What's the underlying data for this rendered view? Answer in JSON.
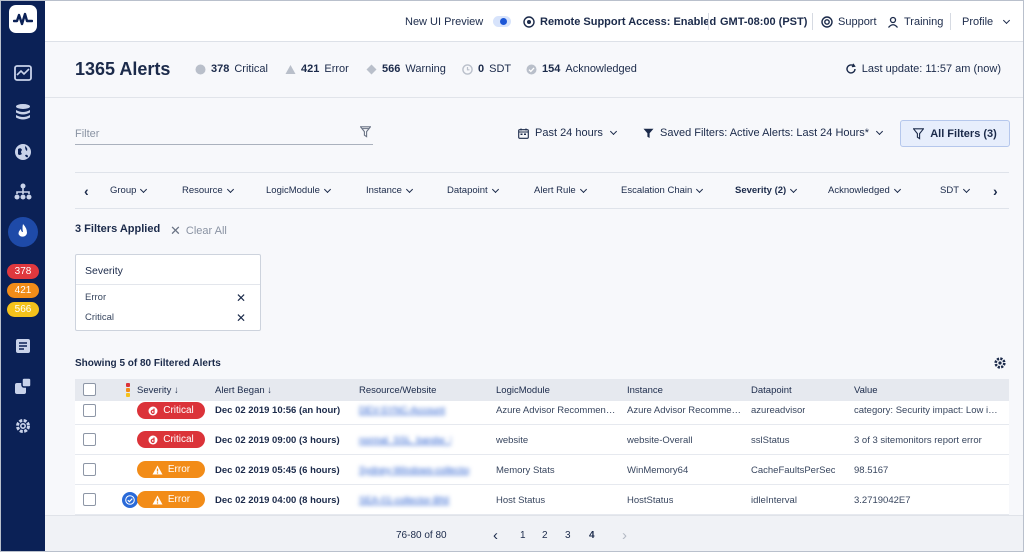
{
  "sidebar": {
    "badges": [
      {
        "value": "378",
        "color": "#e0383e"
      },
      {
        "value": "421",
        "color": "#f28c18"
      },
      {
        "value": "566",
        "color": "#f5c21b"
      }
    ]
  },
  "topbar": {
    "new_ui_preview": "New UI Preview",
    "remote_support": "Remote Support Access: Enabled",
    "timezone": "GMT-08:00 (PST)",
    "support": "Support",
    "training": "Training",
    "profile": "Profile"
  },
  "summary": {
    "title": "1365 Alerts",
    "critical_count": "378",
    "critical_label": "Critical",
    "error_count": "421",
    "error_label": "Error",
    "warning_count": "566",
    "warning_label": "Warning",
    "sdt_count": "0",
    "sdt_label": "SDT",
    "ack_count": "154",
    "ack_label": "Acknowledged",
    "last_update": "Last update: 11:57 am (now)"
  },
  "filters": {
    "placeholder": "Filter",
    "time_range": "Past 24 hours",
    "saved_filters": "Saved Filters: Active Alerts: Last 24 Hours*",
    "all_filters": "All Filters (3)"
  },
  "column_filters": [
    "Group",
    "Resource",
    "LogicModule",
    "Instance",
    "Datapoint",
    "Alert Rule",
    "Escalation Chain",
    "Severity (2)",
    "Acknowledged",
    "SDT"
  ],
  "applied": {
    "label": "3 Filters Applied",
    "clear": "Clear All"
  },
  "severity_card": {
    "title": "Severity",
    "items": [
      "Error",
      "Critical"
    ]
  },
  "table": {
    "showing": "Showing 5 of 80 Filtered Alerts",
    "headers": {
      "severity": "Severity",
      "began": "Alert Began",
      "resource": "Resource/Website",
      "logicmodule": "LogicModule",
      "instance": "Instance",
      "datapoint": "Datapoint",
      "value": "Value"
    },
    "rows": [
      {
        "severity": "Critical",
        "began": "Dec 02 2019 10:56 (an hour)",
        "resource": "DEV-SYNC-Account",
        "logicmodule": "Azure Advisor Recommen…",
        "instance": "Azure Advisor Recomme…",
        "datapoint": "azureadvisor",
        "value": "category: Security impact: Low i…"
      },
      {
        "severity": "Critical",
        "began": "Dec 02 2019 09:00 (3 hours)",
        "resource": "normal_SSL_bandw_l",
        "logicmodule": "website",
        "instance": "website-Overall",
        "datapoint": "sslStatus",
        "value": "3 of 3 sitemonitors report error"
      },
      {
        "severity": "Error",
        "began": "Dec 02 2019 05:45 (6 hours)",
        "resource": "Sydney-Windows-collector",
        "logicmodule": "Memory Stats",
        "instance": "WinMemory64",
        "datapoint": "CacheFaultsPerSec",
        "value": "98.5167"
      },
      {
        "severity": "Error",
        "began": "Dec 02 2019 04:00 (8 hours)",
        "resource": "SEA-01-collector-BNI",
        "logicmodule": "Host Status",
        "instance": "HostStatus",
        "datapoint": "idleInterval",
        "value": "3.2719042E7"
      }
    ]
  },
  "pagination": {
    "range": "76-80 of 80",
    "pages": [
      "1",
      "2",
      "3",
      "4"
    ]
  }
}
